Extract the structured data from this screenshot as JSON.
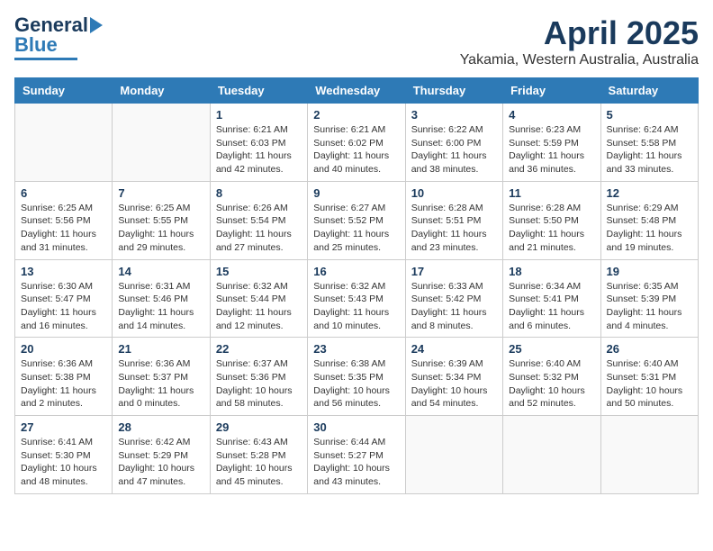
{
  "logo": {
    "general": "General",
    "blue": "Blue"
  },
  "header": {
    "month_year": "April 2025",
    "location": "Yakamia, Western Australia, Australia"
  },
  "weekdays": [
    "Sunday",
    "Monday",
    "Tuesday",
    "Wednesday",
    "Thursday",
    "Friday",
    "Saturday"
  ],
  "weeks": [
    [
      {
        "day": "",
        "info": ""
      },
      {
        "day": "",
        "info": ""
      },
      {
        "day": "1",
        "info": "Sunrise: 6:21 AM\nSunset: 6:03 PM\nDaylight: 11 hours and 42 minutes."
      },
      {
        "day": "2",
        "info": "Sunrise: 6:21 AM\nSunset: 6:02 PM\nDaylight: 11 hours and 40 minutes."
      },
      {
        "day": "3",
        "info": "Sunrise: 6:22 AM\nSunset: 6:00 PM\nDaylight: 11 hours and 38 minutes."
      },
      {
        "day": "4",
        "info": "Sunrise: 6:23 AM\nSunset: 5:59 PM\nDaylight: 11 hours and 36 minutes."
      },
      {
        "day": "5",
        "info": "Sunrise: 6:24 AM\nSunset: 5:58 PM\nDaylight: 11 hours and 33 minutes."
      }
    ],
    [
      {
        "day": "6",
        "info": "Sunrise: 6:25 AM\nSunset: 5:56 PM\nDaylight: 11 hours and 31 minutes."
      },
      {
        "day": "7",
        "info": "Sunrise: 6:25 AM\nSunset: 5:55 PM\nDaylight: 11 hours and 29 minutes."
      },
      {
        "day": "8",
        "info": "Sunrise: 6:26 AM\nSunset: 5:54 PM\nDaylight: 11 hours and 27 minutes."
      },
      {
        "day": "9",
        "info": "Sunrise: 6:27 AM\nSunset: 5:52 PM\nDaylight: 11 hours and 25 minutes."
      },
      {
        "day": "10",
        "info": "Sunrise: 6:28 AM\nSunset: 5:51 PM\nDaylight: 11 hours and 23 minutes."
      },
      {
        "day": "11",
        "info": "Sunrise: 6:28 AM\nSunset: 5:50 PM\nDaylight: 11 hours and 21 minutes."
      },
      {
        "day": "12",
        "info": "Sunrise: 6:29 AM\nSunset: 5:48 PM\nDaylight: 11 hours and 19 minutes."
      }
    ],
    [
      {
        "day": "13",
        "info": "Sunrise: 6:30 AM\nSunset: 5:47 PM\nDaylight: 11 hours and 16 minutes."
      },
      {
        "day": "14",
        "info": "Sunrise: 6:31 AM\nSunset: 5:46 PM\nDaylight: 11 hours and 14 minutes."
      },
      {
        "day": "15",
        "info": "Sunrise: 6:32 AM\nSunset: 5:44 PM\nDaylight: 11 hours and 12 minutes."
      },
      {
        "day": "16",
        "info": "Sunrise: 6:32 AM\nSunset: 5:43 PM\nDaylight: 11 hours and 10 minutes."
      },
      {
        "day": "17",
        "info": "Sunrise: 6:33 AM\nSunset: 5:42 PM\nDaylight: 11 hours and 8 minutes."
      },
      {
        "day": "18",
        "info": "Sunrise: 6:34 AM\nSunset: 5:41 PM\nDaylight: 11 hours and 6 minutes."
      },
      {
        "day": "19",
        "info": "Sunrise: 6:35 AM\nSunset: 5:39 PM\nDaylight: 11 hours and 4 minutes."
      }
    ],
    [
      {
        "day": "20",
        "info": "Sunrise: 6:36 AM\nSunset: 5:38 PM\nDaylight: 11 hours and 2 minutes."
      },
      {
        "day": "21",
        "info": "Sunrise: 6:36 AM\nSunset: 5:37 PM\nDaylight: 11 hours and 0 minutes."
      },
      {
        "day": "22",
        "info": "Sunrise: 6:37 AM\nSunset: 5:36 PM\nDaylight: 10 hours and 58 minutes."
      },
      {
        "day": "23",
        "info": "Sunrise: 6:38 AM\nSunset: 5:35 PM\nDaylight: 10 hours and 56 minutes."
      },
      {
        "day": "24",
        "info": "Sunrise: 6:39 AM\nSunset: 5:34 PM\nDaylight: 10 hours and 54 minutes."
      },
      {
        "day": "25",
        "info": "Sunrise: 6:40 AM\nSunset: 5:32 PM\nDaylight: 10 hours and 52 minutes."
      },
      {
        "day": "26",
        "info": "Sunrise: 6:40 AM\nSunset: 5:31 PM\nDaylight: 10 hours and 50 minutes."
      }
    ],
    [
      {
        "day": "27",
        "info": "Sunrise: 6:41 AM\nSunset: 5:30 PM\nDaylight: 10 hours and 48 minutes."
      },
      {
        "day": "28",
        "info": "Sunrise: 6:42 AM\nSunset: 5:29 PM\nDaylight: 10 hours and 47 minutes."
      },
      {
        "day": "29",
        "info": "Sunrise: 6:43 AM\nSunset: 5:28 PM\nDaylight: 10 hours and 45 minutes."
      },
      {
        "day": "30",
        "info": "Sunrise: 6:44 AM\nSunset: 5:27 PM\nDaylight: 10 hours and 43 minutes."
      },
      {
        "day": "",
        "info": ""
      },
      {
        "day": "",
        "info": ""
      },
      {
        "day": "",
        "info": ""
      }
    ]
  ]
}
